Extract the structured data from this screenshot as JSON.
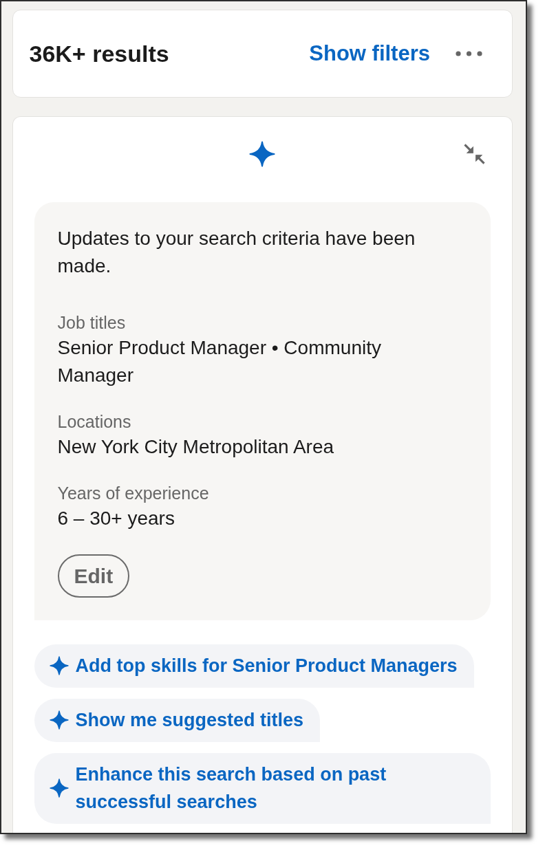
{
  "header": {
    "results": "36K+ results",
    "show_filters": "Show filters"
  },
  "assistant": {
    "message": "Updates to your search criteria have been made.",
    "criteria": [
      {
        "label": "Job titles",
        "value": "Senior Product Manager • Community Manager"
      },
      {
        "label": "Locations",
        "value": "New York City Metropolitan Area"
      },
      {
        "label": "Years of experience",
        "value": "6 – 30+ years"
      }
    ],
    "edit_button": "Edit",
    "suggestions": [
      "Add top skills for Senior Product Managers",
      "Show me suggested titles",
      "Enhance this search based on past successful searches"
    ]
  }
}
